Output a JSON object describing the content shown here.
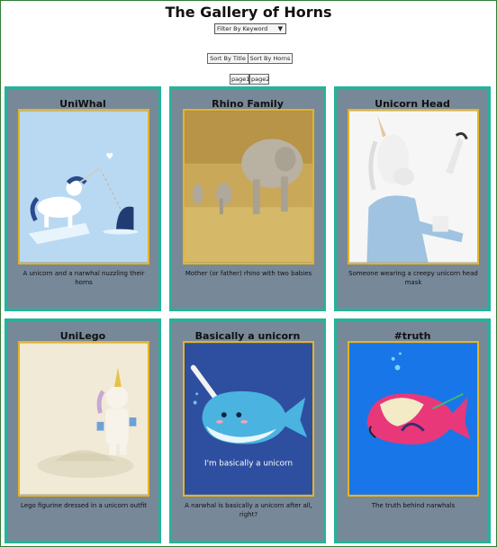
{
  "header": {
    "title": "The Gallery of Horns"
  },
  "filter": {
    "selected": "Filter By Keyword",
    "arrow": "▼"
  },
  "sort": {
    "by_title": "Sort By Title",
    "by_horns": "Sort By Horns"
  },
  "pages": {
    "page1": "page1",
    "page2": "page2"
  },
  "cards": [
    {
      "title": "UniWhal",
      "caption": "A unicorn and a narwhal nuzzling their horns"
    },
    {
      "title": "Rhino Family",
      "caption": "Mother (or father) rhino with two babies"
    },
    {
      "title": "Unicorn Head",
      "caption": "Someone wearing a creepy unicorn head mask"
    },
    {
      "title": "UniLego",
      "caption": "Lego figurine dressed in a unicorn outfit"
    },
    {
      "title": "Basically a unicorn",
      "caption": "A narwhal is basically a unicorn after all, right?",
      "image_text": "I'm basically a unicorn"
    },
    {
      "title": "#truth",
      "caption": "The truth behind narwhals"
    }
  ]
}
